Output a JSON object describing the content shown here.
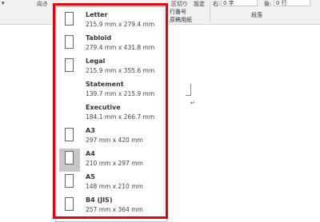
{
  "ribbon": {
    "orientation_label": "向き",
    "breaks_label": "区切り",
    "lines_label": "行番号",
    "setting_label": "設定",
    "group_label": "原稿用紙",
    "indent_right_label": "右:",
    "indent_right_value": "0 字",
    "spacing_after_label": "後:",
    "spacing_after_value": "0 行",
    "paragraph_group_label": "段落"
  },
  "document": {
    "paragraph_mark": "↵"
  },
  "paper_sizes": [
    {
      "name": "Letter",
      "dims": "215.9 mm x 279.4 mm"
    },
    {
      "name": "Tabloid",
      "dims": "279.4 mm x 431.8 mm"
    },
    {
      "name": "Legal",
      "dims": "215.9 mm x 355.6 mm"
    },
    {
      "name": "Statement",
      "dims": "139.7 mm x 215.9 mm"
    },
    {
      "name": "Executive",
      "dims": "184.1 mm x 266.7 mm"
    },
    {
      "name": "A3",
      "dims": "297 mm x 420 mm"
    },
    {
      "name": "A4",
      "dims": "210 mm x 297 mm"
    },
    {
      "name": "A5",
      "dims": "148 mm x 210 mm"
    },
    {
      "name": "B4 (JIS)",
      "dims": "257 mm x 364 mm"
    }
  ],
  "selected_size": "A4",
  "colors": {
    "highlight": "#e3000f",
    "selected_bg": "#c7c7c7"
  }
}
